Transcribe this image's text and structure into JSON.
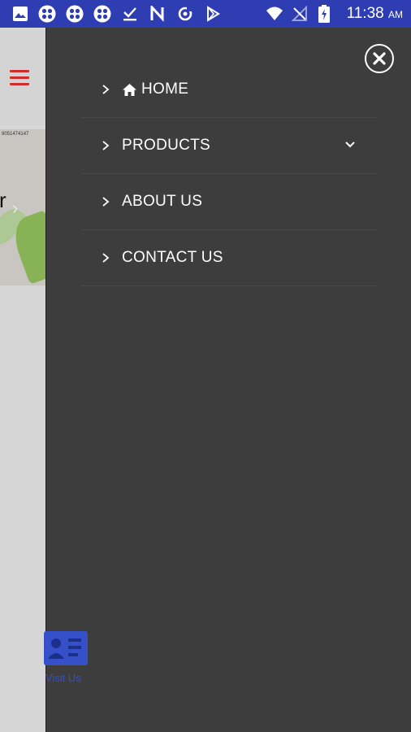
{
  "status_bar": {
    "time": "11:38",
    "ampm": "AM",
    "icons": [
      "image-icon",
      "app-grid-icon",
      "app-grid-icon",
      "app-grid-icon",
      "check-download-icon",
      "n-app-icon",
      "sync-icon",
      "play-store-icon",
      "wifi-icon",
      "signal-icon",
      "battery-charging-icon"
    ]
  },
  "underlay": {
    "banner_text": "9051474147",
    "banner_letter": "r",
    "accent_color": "#d22b2b",
    "fab_label": "Visit Us"
  },
  "drawer": {
    "close_icon": "close-icon",
    "items": [
      {
        "label": "HOME",
        "icon": "home-icon"
      },
      {
        "label": "PRODUCTS",
        "expandable": true
      },
      {
        "label": "ABOUT US"
      },
      {
        "label": "CONTACT US"
      }
    ]
  }
}
